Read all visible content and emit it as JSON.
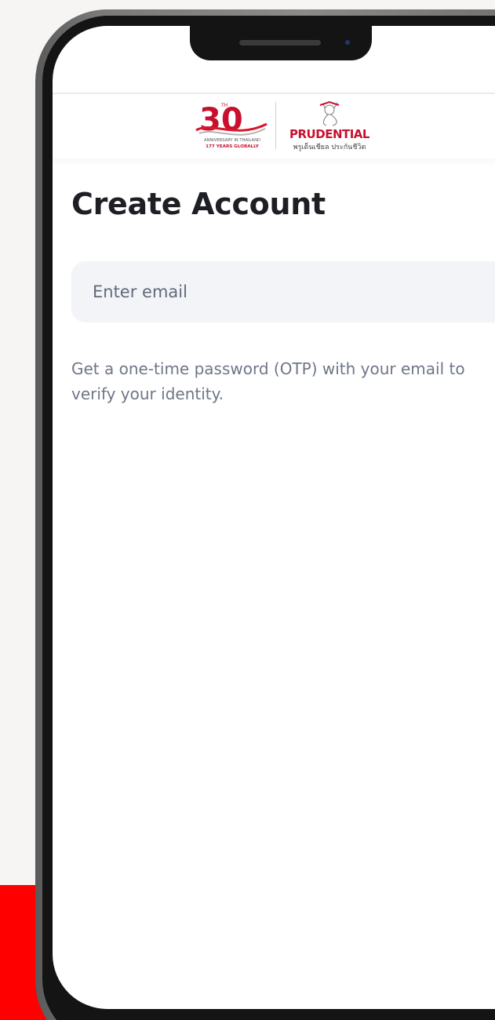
{
  "brand": {
    "anniversary_number": "30",
    "anniversary_suffix": "TH",
    "anniversary_line1": "ANNIVERSARY IN THAILAND",
    "anniversary_line2": "177 YEARS GLOBALLY",
    "company_name": "PRUDENTIAL",
    "company_thai": "พรูเด็นเชียล ประกันชีวิต",
    "brand_red": "#e4002b"
  },
  "page": {
    "title": "Create Account"
  },
  "email_field": {
    "value": "",
    "placeholder": "Enter email"
  },
  "helper": {
    "text": "Get a one-time password (OTP) with your email to verify your identity."
  },
  "colors": {
    "accent_red": "#ff0000",
    "input_background": "#f2f4f8",
    "helper_text": "#6f7687"
  }
}
